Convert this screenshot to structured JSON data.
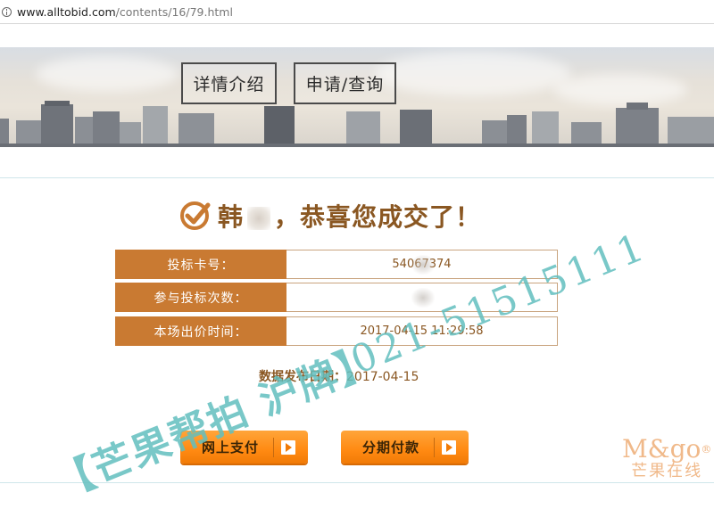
{
  "browser": {
    "url_host": "www.alltobid.com",
    "url_path": "/contents/16/79.html"
  },
  "nav": {
    "details_label": "详情介绍",
    "apply_label": "申请/查询"
  },
  "result": {
    "title_prefix": "韩",
    "title_suffix": "，恭喜您成交了！",
    "rows": [
      {
        "label": "投标卡号：",
        "value": "54067374"
      },
      {
        "label": "参与投标次数：",
        "value": ""
      },
      {
        "label": "本场出价时间：",
        "value": "2017-04-15 11:29:58"
      }
    ],
    "release_label": "数据发布日期：",
    "release_date": "2017-04-15"
  },
  "buttons": {
    "online_pay": "网上支付",
    "installment": "分期付款"
  },
  "watermark": {
    "line1": "【芒果帮拍 沪牌】",
    "line2": "021-51515111"
  },
  "logo": {
    "en": "M&go",
    "reg": "®",
    "cn": "芒果在线"
  },
  "colors": {
    "label_bg": "#c97a32",
    "title_text": "#8a5722",
    "button_orange": "#ff8a12",
    "watermark_teal": "#62bebe"
  }
}
